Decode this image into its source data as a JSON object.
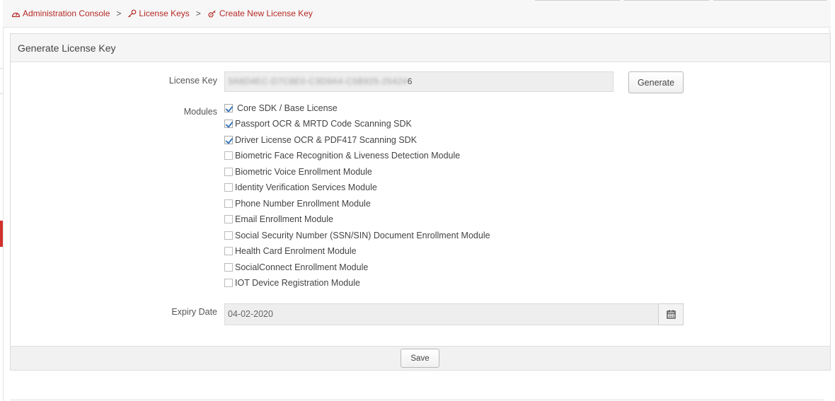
{
  "breadcrumb": {
    "items": [
      {
        "label": "Administration Console",
        "icon": "dashboard-icon"
      },
      {
        "label": "License Keys",
        "icon": "key-icon"
      },
      {
        "label": "Create New License Key",
        "icon": "key-add-icon"
      }
    ],
    "separator": ">"
  },
  "panel": {
    "title": "Generate License Key"
  },
  "form": {
    "license_key_label": "License Key",
    "license_key_value_hidden": "3A8D4EC-D7C8E0-C3D9A4-C5B925-25424",
    "license_key_value_visible": "6",
    "generate_label": "Generate",
    "modules_label": "Modules",
    "modules": [
      {
        "label": "Core SDK / Base License",
        "checked": true
      },
      {
        "label": "Passport OCR & MRTD Code Scanning SDK",
        "checked": true
      },
      {
        "label": "Driver License OCR & PDF417 Scanning SDK",
        "checked": true
      },
      {
        "label": "Biometric Face Recognition & Liveness Detection Module",
        "checked": false
      },
      {
        "label": "Biometric Voice Enrollment Module",
        "checked": false
      },
      {
        "label": "Identity Verification Services Module",
        "checked": false
      },
      {
        "label": "Phone Number Enrollment Module",
        "checked": false
      },
      {
        "label": "Email Enrollment Module",
        "checked": false
      },
      {
        "label": "Social Security Number (SSN/SIN) Document Enrollment Module",
        "checked": false
      },
      {
        "label": "Health Card Enrolment Module",
        "checked": false
      },
      {
        "label": "SocialConnect Enrollment Module",
        "checked": false
      },
      {
        "label": "IOT Device Registration Module",
        "checked": false
      }
    ],
    "expiry_label": "Expiry Date",
    "expiry_value": "04-02-2020",
    "calendar_icon": "calendar-icon"
  },
  "footer": {
    "save_label": "Save"
  },
  "colors": {
    "accent": "#b52a26",
    "marker": "#d0312d",
    "check": "#3a7ab8"
  }
}
